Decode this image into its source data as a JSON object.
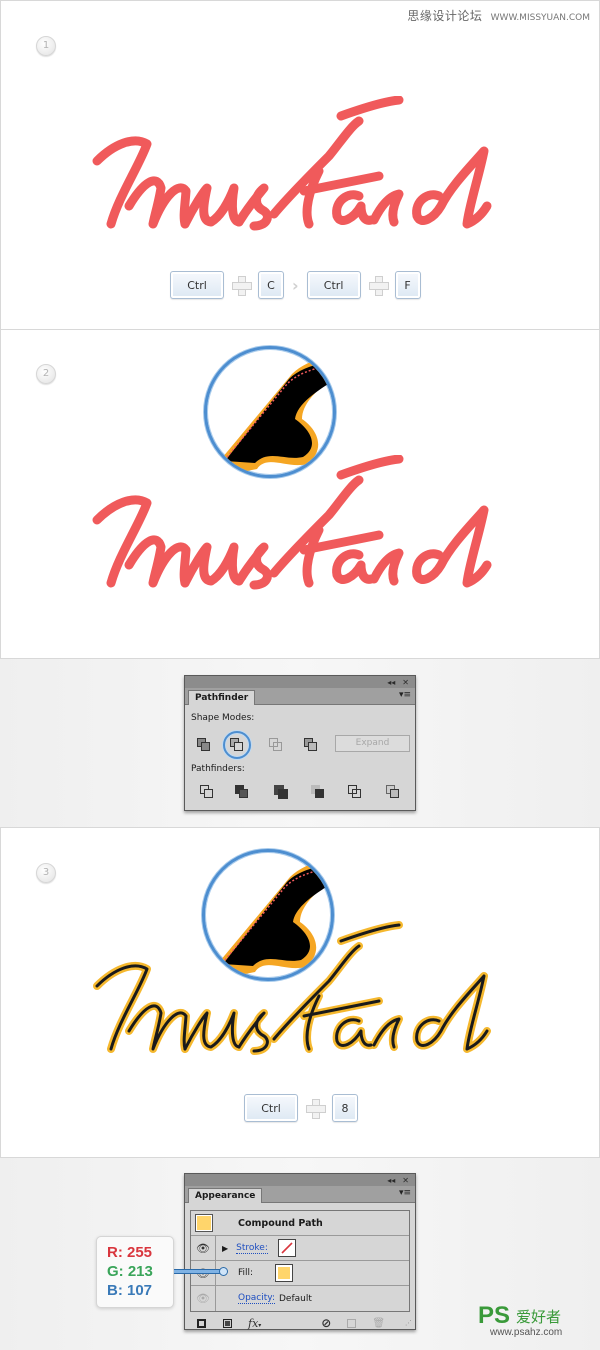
{
  "watermark_top": {
    "site_name": "思缘设计论坛",
    "url": "WWW.MISSYUAN.COM"
  },
  "step1": {
    "number": "1",
    "lettering": "mustard",
    "lettering_color": "#f05a5b",
    "shortcut": [
      {
        "key": "Ctrl"
      },
      {
        "sep": "plus"
      },
      {
        "key": "C"
      },
      {
        "sep": "then"
      },
      {
        "key": "Ctrl"
      },
      {
        "sep": "plus"
      },
      {
        "key": "F"
      }
    ],
    "keys": {
      "k1": "Ctrl",
      "k2": "C",
      "k3": "Ctrl",
      "k4": "F"
    }
  },
  "step2": {
    "number": "2",
    "lettering": "mustard",
    "lettering_color": "#f05a5b"
  },
  "pathfinder_panel": {
    "tab": "Pathfinder",
    "collapse_icon": "◂◂",
    "close_icon": "✕",
    "menu_icon": "▾≡",
    "shape_modes_label": "Shape Modes:",
    "shape_modes": [
      "Unite",
      "Minus Front",
      "Intersect",
      "Exclude"
    ],
    "highlighted_shape_mode": "Minus Front",
    "expand_label": "Expand",
    "pathfinders_label": "Pathfinders:",
    "pathfinders": [
      "Divide",
      "Trim",
      "Merge",
      "Crop",
      "Outline",
      "Minus Back"
    ]
  },
  "step3": {
    "number": "3",
    "lettering": "mustard",
    "lettering_color": "#f5b82e",
    "keys": {
      "k1": "Ctrl",
      "k2": "8"
    }
  },
  "appearance_panel": {
    "tab": "Appearance",
    "collapse_icon": "◂◂",
    "close_icon": "✕",
    "menu_icon": "▾≡",
    "object_type": "Compound Path",
    "object_swatch_color": "#ffd56b",
    "rows": [
      {
        "label": "Stroke:",
        "swatch": "none"
      },
      {
        "label": "Fill:",
        "swatch": "#ffd56b"
      },
      {
        "label": "Opacity:",
        "value": "Default"
      }
    ],
    "stroke_label": "Stroke:",
    "fill_label": "Fill:",
    "opacity_label": "Opacity:",
    "opacity_value": "Default",
    "fill_color": "#ffd56b",
    "fx_label": "fx"
  },
  "rgb_callout": {
    "r": "R: 255",
    "g": "G: 213",
    "b": "B: 107",
    "r_color": "#d9363e",
    "g_color": "#3aa55a",
    "b_color": "#3a7ab8"
  },
  "watermark_bottom": {
    "brand": "PS",
    "cn_text": "爱好者",
    "url": "www.psahz.com"
  }
}
